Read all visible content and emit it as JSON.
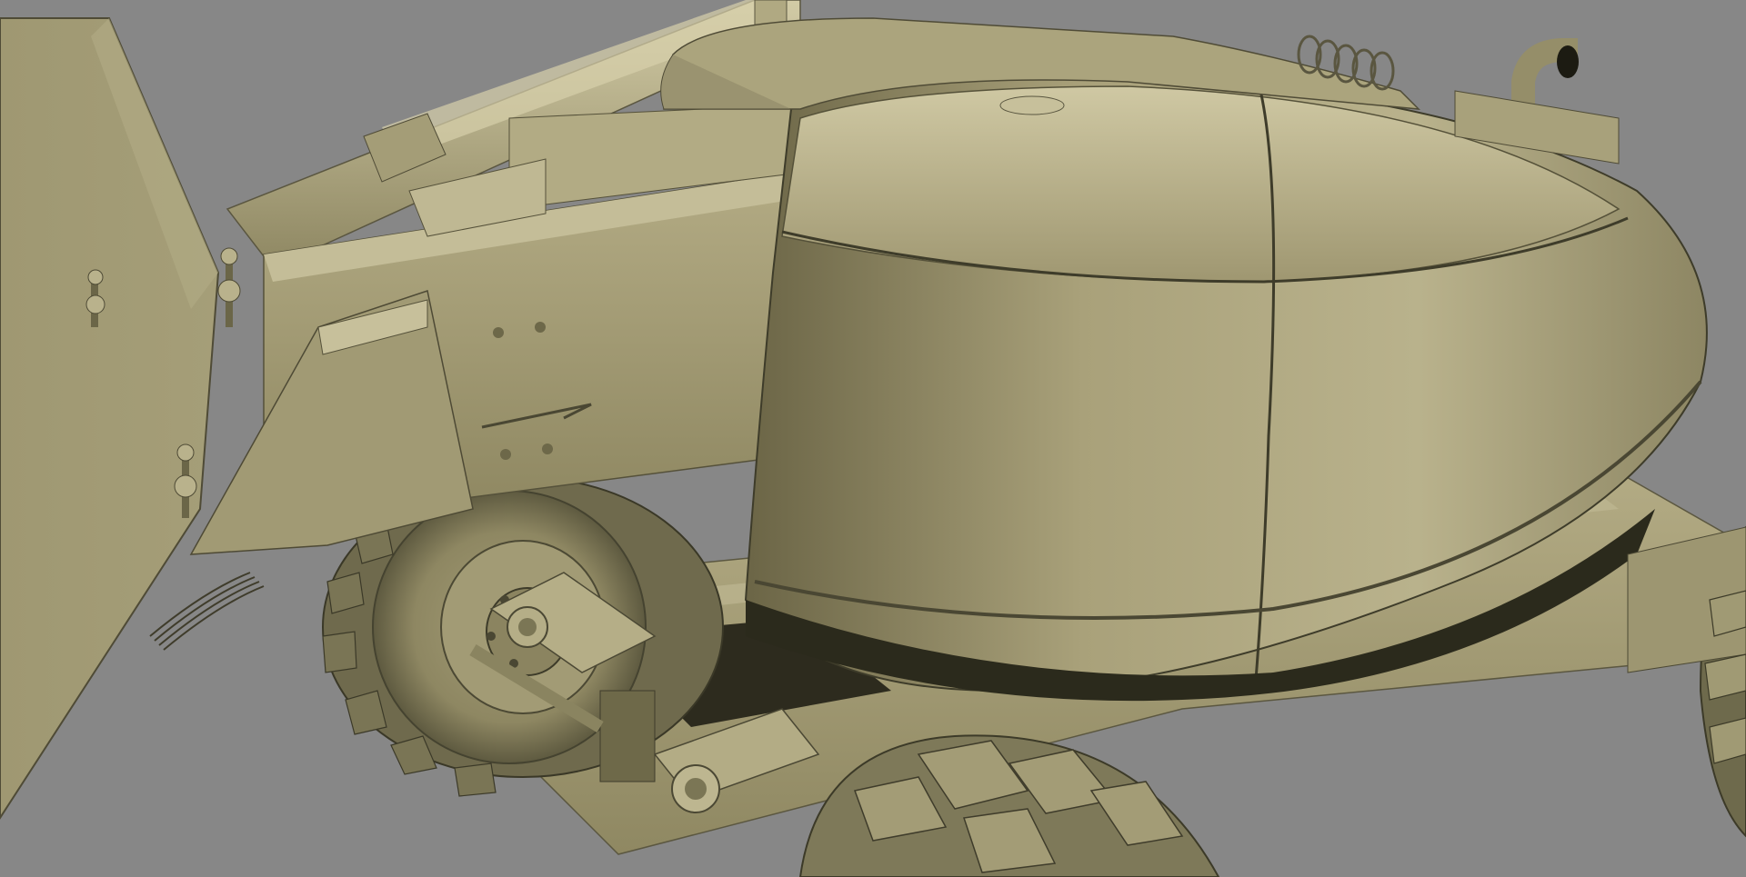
{
  "viewport": {
    "background_color": "#878787",
    "model_base_color": "#a8a07a",
    "model_highlight_color": "#c8c19c",
    "model_shadow_color": "#2b2a1c",
    "tire_color": "#7c7758"
  },
  "scene": {
    "subject_icon": "aerial-work-platform-model"
  }
}
